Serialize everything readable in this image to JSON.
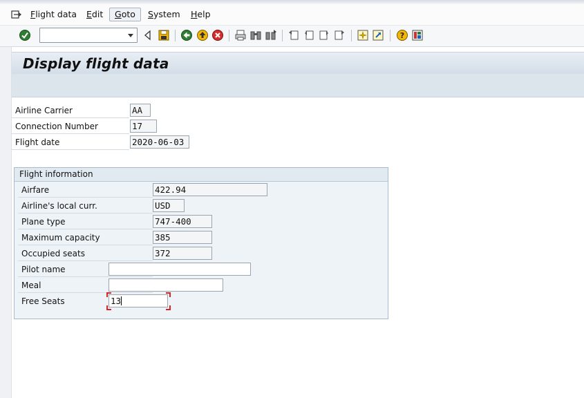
{
  "menu": {
    "items": [
      {
        "label": "Flight data",
        "underline": "F",
        "rest": "light data"
      },
      {
        "label": "Edit",
        "underline": "E",
        "rest": "dit"
      },
      {
        "label": "Goto",
        "underline": "G",
        "rest": "oto"
      },
      {
        "label": "System",
        "underline": "S",
        "rest": "ystem"
      },
      {
        "label": "Help",
        "underline": "H",
        "rest": "elp"
      }
    ]
  },
  "toolbar": {
    "command_field_value": "",
    "icons": [
      "enter-icon",
      "back-triangle-icon",
      "save-icon",
      "back-icon",
      "exit-icon",
      "cancel-icon",
      "print-icon",
      "find-icon",
      "find-next-icon",
      "first-page-icon",
      "previous-page-icon",
      "next-page-icon",
      "last-page-icon",
      "create-session-icon",
      "shortcut-icon",
      "help-icon",
      "customize-layout-icon"
    ]
  },
  "title": "Display flight data",
  "header_fields": [
    {
      "label": "Airline Carrier",
      "value": "AA"
    },
    {
      "label": "Connection Number",
      "value": "17"
    },
    {
      "label": "Flight date",
      "value": "2020-06-03"
    }
  ],
  "flight_info": {
    "title": "Flight information",
    "fields": [
      {
        "label": "Airfare",
        "value": "422.94"
      },
      {
        "label": "Airline's local curr.",
        "value": "USD"
      },
      {
        "label": "Plane type",
        "value": "747-400"
      },
      {
        "label": "Maximum capacity",
        "value": "385"
      },
      {
        "label": "Occupied seats",
        "value": "372"
      },
      {
        "label": "Pilot name",
        "value": ""
      },
      {
        "label": "Meal",
        "value": ""
      },
      {
        "label": "Free Seats",
        "value": "13"
      }
    ]
  },
  "colors": {
    "title_bar": "#d3dde8",
    "group_border": "#a8bacd",
    "focus": "#dd2222"
  }
}
